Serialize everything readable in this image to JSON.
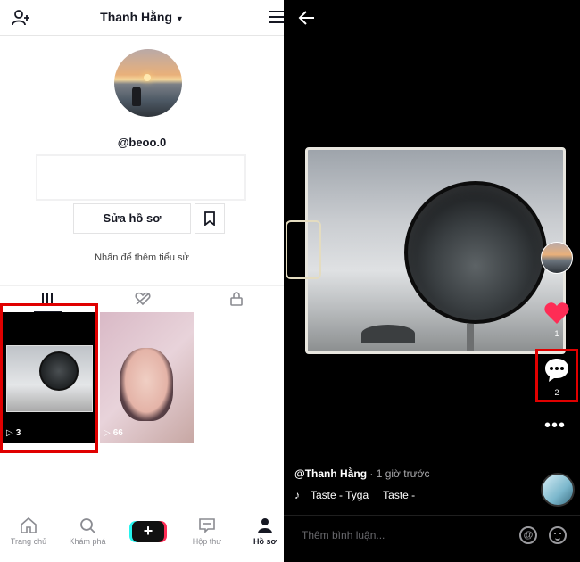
{
  "profile": {
    "display_name": "Thanh Hằng",
    "username": "@beoo.0",
    "edit_label": "Sửa hồ sơ",
    "bio_hint": "Nhấn để thêm tiểu sử"
  },
  "videos": [
    {
      "play_count": "3"
    },
    {
      "play_count": "66"
    }
  ],
  "nav": {
    "home": "Trang chủ",
    "discover": "Khám phá",
    "create": "+",
    "inbox": "Hộp thư",
    "profile": "Hồ sơ"
  },
  "player": {
    "like_count": "1",
    "comment_count": "2",
    "author": "@Thanh Hằng",
    "time": " · 1 giờ trước",
    "music_1": "Taste - Tyga",
    "music_2": "Taste - ",
    "comment_placeholder": "Thêm bình luận..."
  },
  "colors": {
    "highlight": "#e00000",
    "like": "#fe2c55"
  }
}
